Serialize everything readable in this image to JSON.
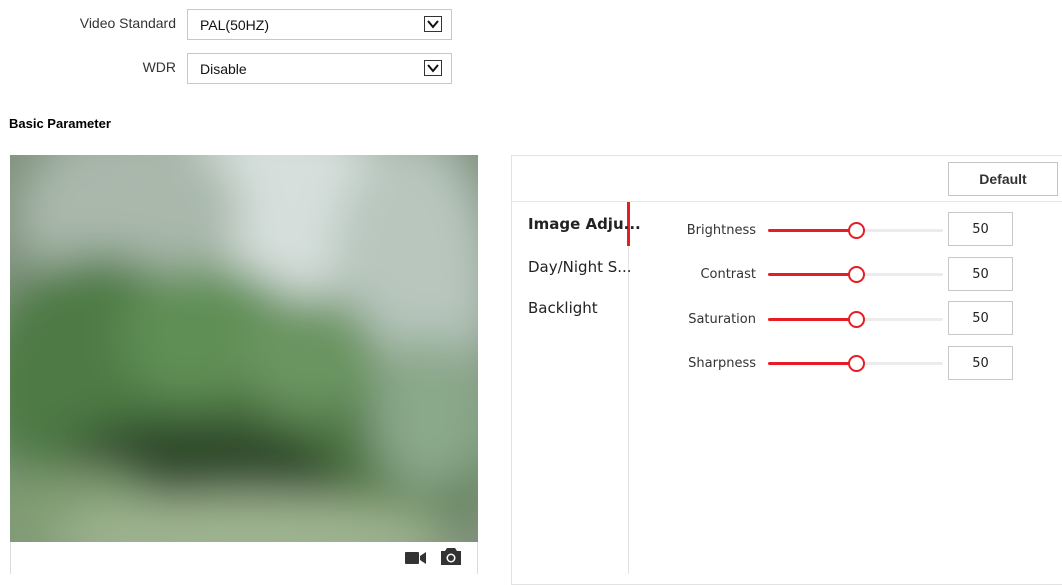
{
  "settings": {
    "video_standard": {
      "label": "Video Standard",
      "value": "PAL(50HZ)"
    },
    "wdr": {
      "label": "WDR",
      "value": "Disable"
    }
  },
  "section_title": "Basic Parameter",
  "preview": {
    "icons": [
      "video-camera-icon",
      "camera-snapshot-icon"
    ]
  },
  "panel": {
    "default_label": "Default",
    "tabs": [
      {
        "label": "Image Adju...",
        "active": true
      },
      {
        "label": "Day/Night S...",
        "active": false
      },
      {
        "label": "Backlight",
        "active": false
      }
    ],
    "sliders": [
      {
        "label": "Brightness",
        "value": "50",
        "level": 50
      },
      {
        "label": "Contrast",
        "value": "50",
        "level": 50
      },
      {
        "label": "Saturation",
        "value": "50",
        "level": 50
      },
      {
        "label": "Sharpness",
        "value": "50",
        "level": 50
      }
    ]
  },
  "colors": {
    "accent": "#e81c24",
    "border": "#c8c8c8"
  }
}
